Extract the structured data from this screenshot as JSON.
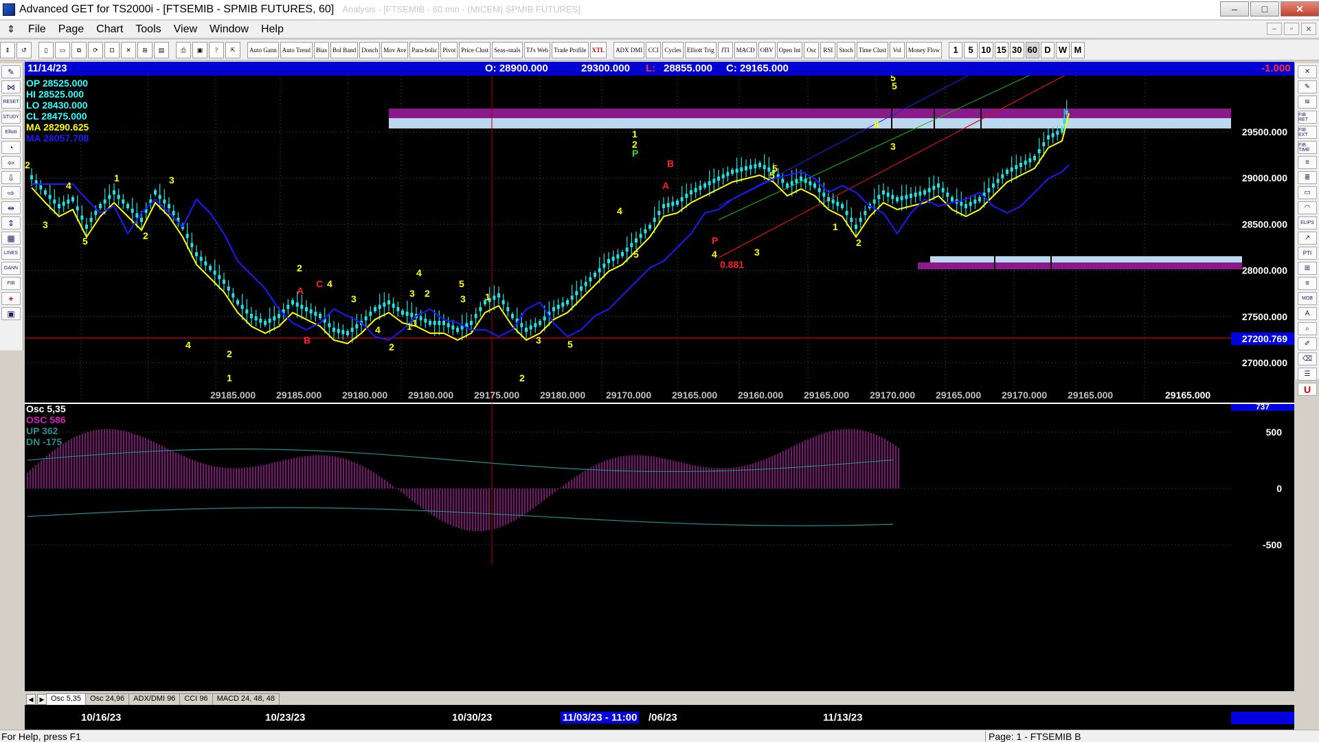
{
  "window": {
    "title": "Advanced GET for TS2000i - [FTSEMIB - SPMIB FUTURES, 60]",
    "faded_title": "Analysis - [FTSEMIB - 60 min - (MICEM) SPMIB FUTURES]",
    "minimize": "–",
    "maximize": "□",
    "close": "✕"
  },
  "menu": {
    "items": [
      "File",
      "Page",
      "Chart",
      "Tools",
      "View",
      "Window",
      "Help"
    ],
    "mdi": [
      "–",
      "▫",
      "✕"
    ]
  },
  "toolbar": {
    "study_buttons": [
      "Auto Gann",
      "Auto Trend",
      "Bias",
      "Bol Band",
      "Donch",
      "Mov Ave",
      "Para-bolic",
      "Pivot",
      "Price Clust",
      "Seas-onals",
      "TJ's Web",
      "Trade Profile",
      "XTL"
    ],
    "indicator_buttons": [
      "ADX DMI",
      "CCI",
      "Cycles",
      "Elliott Trig",
      "JTI",
      "MACD",
      "OBV",
      "Open Int",
      "Osc",
      "RSI",
      "Stoch",
      "Time Clust",
      "Vol",
      "Money Flow"
    ],
    "periods": [
      "1",
      "5",
      "10",
      "15",
      "30",
      "60",
      "D",
      "W",
      "M"
    ],
    "active_period": "60"
  },
  "info_bar": {
    "date": "11/14/23",
    "open": "O: 28900.000",
    "high": "29300.000",
    "low_label": "L:",
    "low": "28855.000",
    "close": "C: 29165.000",
    "change": "-1.000"
  },
  "readout": {
    "op": "OP  28525.000",
    "hi": "HI   28525.000",
    "lo": "LO  28430.000",
    "cl": "CL  28475.000",
    "ma1": "MA  28290.625",
    "ma2": "MA  28057.708"
  },
  "price_axis": {
    "labels": [
      "29500.000",
      "29000.000",
      "28500.000",
      "28000.000",
      "27500.000",
      "27000.000"
    ],
    "highlight": "27200.769"
  },
  "bottom_values": {
    "labels": [
      "29185.000",
      "29185.000",
      "29180.000",
      "29180.000",
      "29175.000",
      "29180.000",
      "29170.000",
      "29165.000",
      "29160.000",
      "29165.000",
      "29170.000",
      "29165.000",
      "29170.000",
      "29165.000"
    ],
    "last": "29165.000"
  },
  "elliott_labels": {
    "yellow": [
      "2",
      "4",
      "3",
      "5",
      "1",
      "2",
      "3",
      "4",
      "2",
      "1",
      "2",
      "4",
      "3",
      "4",
      "2",
      "1",
      "3",
      "4",
      "2",
      "1",
      "5",
      "3",
      "1",
      "2",
      "3",
      "5",
      "4",
      "5",
      "1",
      "2",
      "4",
      "3",
      "5",
      "5",
      "1",
      "2",
      "4",
      "3",
      "5",
      "5"
    ],
    "red": [
      "A",
      "C",
      "B",
      "A",
      "B",
      "P"
    ],
    "green": [
      "P"
    ],
    "ratio": "0.881"
  },
  "osc_panel": {
    "osc_title": "Osc 5,35",
    "osc_value": "OSC 586",
    "up": "UP    362",
    "dn": "DN   -175",
    "axis": [
      "500",
      "0",
      "-500"
    ],
    "top_value": "737"
  },
  "osc_tabs": [
    "Osc 5,35",
    "Osc 24,96",
    "ADX/DMI 96",
    "CCI 96",
    "MACD 24, 48, 48"
  ],
  "date_axis": {
    "labels": [
      "10/16/23",
      "10/23/23",
      "10/30/23",
      "/06/23",
      "11/13/23"
    ],
    "cursor": "11/03/23 - 11:00"
  },
  "status": {
    "help": "For Help, press F1",
    "page": "Page: 1 - FTSEMIB B"
  },
  "colors": {
    "ma_fast": "#ffff00",
    "ma_slow": "#1a1aff",
    "candles": "#20e0e0",
    "osc_bars": "#d020c0",
    "zone_purple": "#8a1a8a",
    "zone_light": "#bcd8f0",
    "support_line": "#c00000"
  }
}
